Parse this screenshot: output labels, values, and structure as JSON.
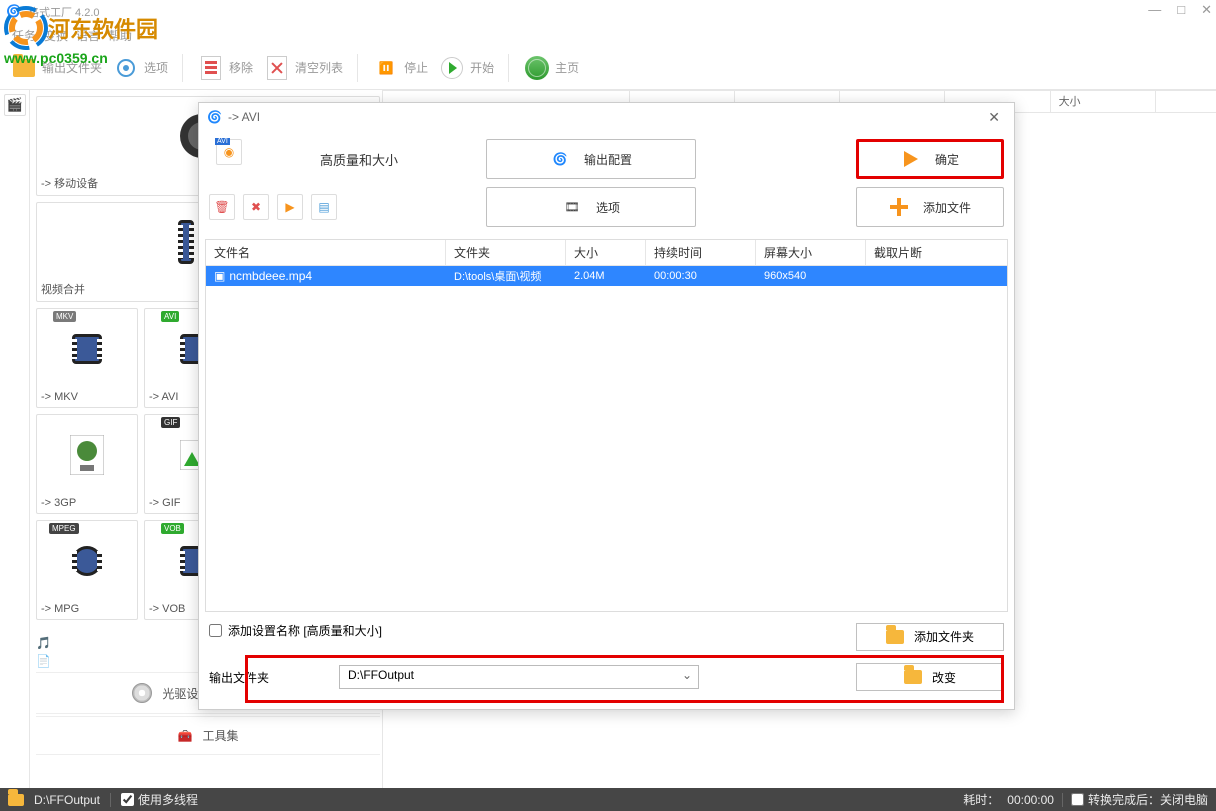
{
  "app": {
    "title": "格式工厂 4.2.0"
  },
  "watermark": {
    "name": "河东软件园",
    "url": "www.pc0359.cn"
  },
  "menu": [
    "任务",
    "变换",
    "语言",
    "帮助"
  ],
  "toolbar": {
    "output_folder": "输出文件夹",
    "options": "选项",
    "remove": "移除",
    "clear_list": "清空列表",
    "stop": "停止",
    "start": "开始",
    "home": "主页"
  },
  "right_headers": [
    "大小"
  ],
  "sidebar": {
    "cards": [
      {
        "label": "-> 移动设备"
      },
      {
        "label": "视频合并"
      },
      {
        "label": "-> MKV"
      },
      {
        "label": "-> AVI"
      },
      {
        "label": "-> 3GP"
      },
      {
        "label": "-> GIF"
      },
      {
        "label": "-> MPG"
      },
      {
        "label": "-> VOB"
      }
    ],
    "rows": [
      "光驱设备\\DVD\\CD\\ISO",
      "工具集"
    ]
  },
  "dialog": {
    "title": "-> AVI",
    "quality_label": "高质量和大小",
    "output_config": "输出配置",
    "ok": "确定",
    "options": "选项",
    "add_file": "添加文件",
    "columns": {
      "filename": "文件名",
      "folder": "文件夹",
      "size": "大小",
      "duration": "持续时间",
      "screen": "屏幕大小",
      "clip": "截取片断"
    },
    "rows": [
      {
        "name": "ncmbdeee.mp4",
        "folder": "D:\\tools\\桌面\\视频",
        "size": "2.04M",
        "duration": "00:00:30",
        "screen": "960x540",
        "clip": ""
      }
    ],
    "add_settings_label": "添加设置名称 [高质量和大小]",
    "add_folder": "添加文件夹",
    "output_folder_label": "输出文件夹",
    "output_folder_value": "D:\\FFOutput",
    "change": "改变"
  },
  "status": {
    "path_icon_path": "D:\\FFOutput",
    "multithread": "使用多线程",
    "elapsed_label": "耗时：",
    "elapsed": "00:00:00",
    "after_done": "转换完成后：关闭电脑"
  }
}
